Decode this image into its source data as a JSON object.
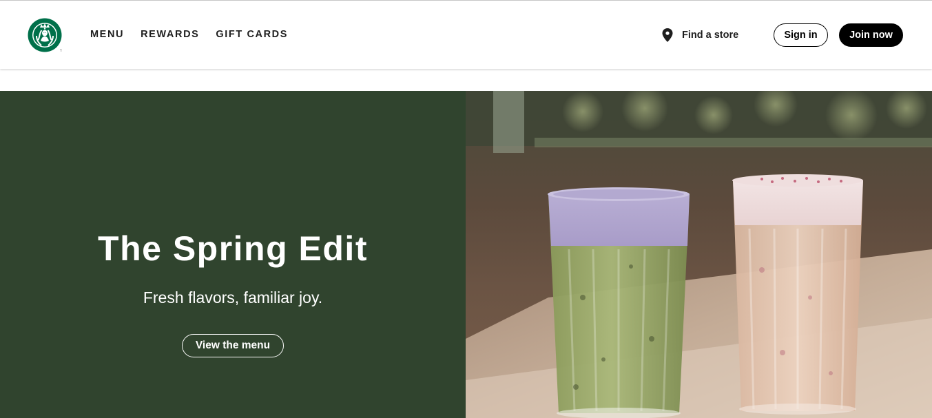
{
  "header": {
    "logo": {
      "icon": "starbucks-siren-logo",
      "color": "#00704A"
    },
    "nav": [
      {
        "label": "MENU"
      },
      {
        "label": "REWARDS"
      },
      {
        "label": "GIFT CARDS"
      }
    ],
    "find_store": {
      "icon": "location-pin-icon",
      "label": "Find a store"
    },
    "sign_in_label": "Sign in",
    "join_now_label": "Join now"
  },
  "hero": {
    "title": "The Spring Edit",
    "subtitle": "Fresh flavors, familiar joy.",
    "cta_label": "View the menu",
    "panel_color": "#30442E",
    "image": {
      "icon": "iced-drinks-photo"
    }
  }
}
